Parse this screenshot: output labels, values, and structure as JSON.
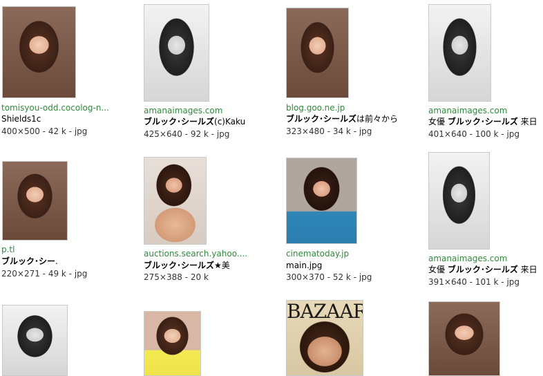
{
  "results": [
    {
      "source": "tomisyou-odd.cocolog-n...",
      "caption_pre": "",
      "caption_bold": "",
      "caption_post": "Shields1c",
      "meta": "400×500 - 42 k - jpg",
      "thumb_style": "color",
      "thumb_text": ""
    },
    {
      "source": "amanaimages.com",
      "caption_pre": "",
      "caption_bold": "ブルック･シールズ",
      "caption_post": "(c)Kaku",
      "meta": "425×640 - 92 k - jpg",
      "thumb_style": "gray",
      "thumb_text": ""
    },
    {
      "source": "blog.goo.ne.jp",
      "caption_pre": "",
      "caption_bold": "ブルック･シールズ",
      "caption_post": "は前々から",
      "meta": "323×480 - 34 k - jpg",
      "thumb_style": "color",
      "thumb_text": ""
    },
    {
      "source": "amanaimages.com",
      "caption_pre": "女優 ",
      "caption_bold": "ブルック･シールズ",
      "caption_post": " 来日",
      "meta": "401×640 - 100 k - jpg",
      "thumb_style": "gray",
      "thumb_text": ""
    },
    {
      "source": "p.tl",
      "caption_pre": "",
      "caption_bold": "ブルック･シー",
      "caption_post": ".",
      "meta": "220×271 - 49 k - jpg",
      "thumb_style": "color",
      "thumb_text": ""
    },
    {
      "source": "auctions.search.yahoo....",
      "caption_pre": "",
      "caption_bold": "ブルック･シールズ",
      "caption_post": "★美",
      "meta": "275×388 - 20 k",
      "thumb_style": "skin",
      "thumb_text": ""
    },
    {
      "source": "cinematoday.jp",
      "caption_pre": "",
      "caption_bold": "",
      "caption_post": "main.jpg",
      "meta": "300×370 - 52 k - jpg",
      "thumb_style": "blue",
      "thumb_text": ""
    },
    {
      "source": "amanaimages.com",
      "caption_pre": "女優 ",
      "caption_bold": "ブルック･シールズ",
      "caption_post": " 来日",
      "meta": "391×640 - 101 k - jpg",
      "thumb_style": "gray",
      "thumb_text": ""
    },
    {
      "source": "",
      "caption_pre": "",
      "caption_bold": "",
      "caption_post": "",
      "meta": "",
      "thumb_style": "gray",
      "thumb_text": ""
    },
    {
      "source": "",
      "caption_pre": "",
      "caption_bold": "",
      "caption_post": "",
      "meta": "",
      "thumb_style": "yellow",
      "thumb_text": ""
    },
    {
      "source": "",
      "caption_pre": "",
      "caption_bold": "",
      "caption_post": "",
      "meta": "",
      "thumb_style": "bazaar",
      "thumb_text": "BAZAAR"
    },
    {
      "source": "",
      "caption_pre": "",
      "caption_bold": "",
      "caption_post": "",
      "meta": "",
      "thumb_style": "color",
      "thumb_text": ""
    }
  ]
}
